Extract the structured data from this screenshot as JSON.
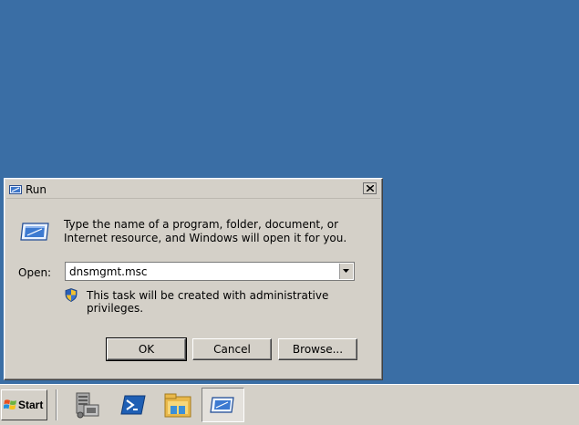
{
  "dialog": {
    "title": "Run",
    "title_icon": "run-icon",
    "close_icon": "close-icon",
    "description": "Type the name of a program, folder, document, or Internet resource, and Windows will open it for you.",
    "open_label": "Open:",
    "open_value": "dnsmgmt.msc",
    "admin_notice": "This task will be created with administrative privileges.",
    "buttons": {
      "ok": "OK",
      "cancel": "Cancel",
      "browse": "Browse..."
    }
  },
  "taskbar": {
    "start_label": "Start",
    "pinned": [
      {
        "icon": "server-manager-icon"
      },
      {
        "icon": "powershell-icon"
      },
      {
        "icon": "windows-explorer-icon"
      },
      {
        "icon": "run-icon",
        "active": true
      }
    ]
  },
  "colors": {
    "desktop": "#3a6ea5",
    "window": "#d4d0c8",
    "powershell": "#1f5fb4",
    "shield_blue": "#2a5fb8",
    "shield_yellow": "#f2c12e"
  }
}
